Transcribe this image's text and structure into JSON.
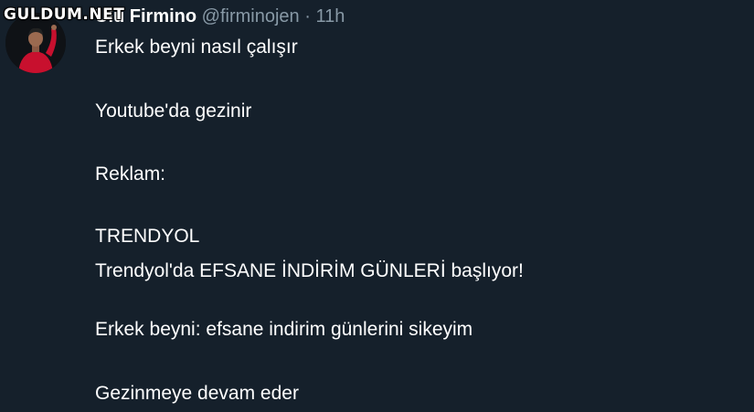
{
  "watermark": "GULDUM.NET",
  "tweet": {
    "author_name": "Ulu Firmino",
    "handle": "@firminojen",
    "separator": "·",
    "time": "11h",
    "lines": [
      "Erkek beyni nasıl çalışır",
      "Youtube'da gezinir",
      "Reklam:",
      "TRENDYOL",
      "Trendyol'da EFSANE İNDİRİM GÜNLERİ başlıyor!",
      "Erkek beyni: efsane indirim günlerini sikeyim",
      "Gezinmeye devam eder"
    ]
  },
  "colors": {
    "background": "#15202b",
    "text": "#ffffff",
    "secondary": "#8899a6",
    "jersey": "#c8102e"
  }
}
